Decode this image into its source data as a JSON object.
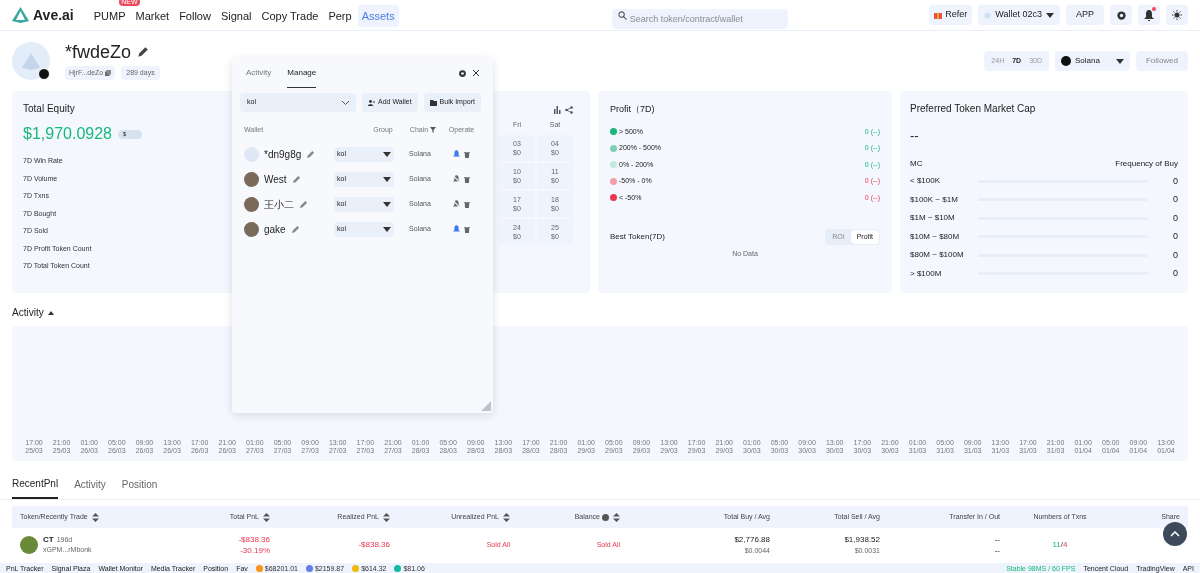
{
  "nav": {
    "logo": "Ave.ai",
    "items": [
      {
        "label": "PUMP",
        "badge": "NEW",
        "selected": false
      },
      {
        "label": "Market",
        "selected": false
      },
      {
        "label": "Follow",
        "selected": false
      },
      {
        "label": "Signal",
        "selected": false
      },
      {
        "label": "Copy Trade",
        "selected": false
      },
      {
        "label": "Perp",
        "selected": false
      },
      {
        "label": "Assets",
        "selected": true
      }
    ],
    "search": {
      "placeholder": "Search token/contract/wallet"
    },
    "refer": "Refer",
    "wallet": "Wallet 02c3",
    "app": "APP",
    "notification_dot": true
  },
  "profile": {
    "name": "*fwdeZo",
    "address": "HjrF...deZo",
    "age": "289 days",
    "periods": [
      {
        "label": "24H",
        "selected": false
      },
      {
        "label": "7D",
        "selected": true
      },
      {
        "label": "30D",
        "selected": false
      }
    ],
    "chain": "Solana",
    "follow": "Followed"
  },
  "equity": {
    "title": "Total Equity",
    "value": "$1,970.0928",
    "currency": "$",
    "stats": [
      "7D Win Rate",
      "7D Volume",
      "7D Txns",
      "7D Bought",
      "7D Sold",
      "7D Profit Token Count",
      "7D Total Token Count"
    ]
  },
  "calendar": {
    "days": [
      "Fri",
      "Sat"
    ],
    "weeks": [
      [
        {
          "date": "03",
          "amount": "$0"
        },
        {
          "date": "04",
          "amount": "$0"
        }
      ],
      [
        {
          "date": "10",
          "amount": "$0"
        },
        {
          "date": "11",
          "amount": "$0"
        }
      ],
      [
        {
          "date": "17",
          "amount": "$0"
        },
        {
          "date": "18",
          "amount": "$0"
        }
      ],
      [
        {
          "date": "24",
          "amount": "$0"
        },
        {
          "date": "25",
          "amount": "$0"
        }
      ]
    ]
  },
  "profit": {
    "title": "Profit（7D)",
    "buckets": [
      {
        "label": "> 500%",
        "value": "0 (--)",
        "color": "#16b979",
        "kind": "gain"
      },
      {
        "label": "200% - 500%",
        "value": "0 (--)",
        "color": "#7fd0b0",
        "kind": "gain"
      },
      {
        "label": "0% - 200%",
        "value": "0 (--)",
        "color": "#c6e8dc",
        "kind": "gain"
      },
      {
        "label": "-50% - 0%",
        "value": "0 (--)",
        "color": "#f3a0ad",
        "kind": "loss"
      },
      {
        "label": "< -50%",
        "value": "0 (--)",
        "color": "#e8384f",
        "kind": "loss"
      }
    ],
    "best_title": "Best Token(7D)",
    "toggle": [
      {
        "label": "ROI",
        "selected": false
      },
      {
        "label": "Profit",
        "selected": true
      }
    ],
    "empty": "No Data"
  },
  "market_cap": {
    "title": "Preferred Token Market Cap",
    "value": "--",
    "col1": "MC",
    "col2": "Frequency of Buy",
    "rows": [
      {
        "range": "< $100K",
        "count": "0",
        "level": 0
      },
      {
        "range": "$100K ~ $1M",
        "count": "0",
        "level": 0
      },
      {
        "range": "$1M ~ $10M",
        "count": "0",
        "level": 0
      },
      {
        "range": "$10M ~ $80M",
        "count": "0",
        "level": 0
      },
      {
        "range": "$80M ~ $100M",
        "count": "0",
        "level": 0
      },
      {
        "range": "> $100M",
        "count": "0",
        "level": 0
      }
    ]
  },
  "activity": {
    "title": "Activity",
    "expanded": true,
    "time_labels": [
      [
        "17:00",
        "25/03"
      ],
      [
        "21:00",
        "25/03"
      ],
      [
        "01:00",
        "26/03"
      ],
      [
        "05:00",
        "26/03"
      ],
      [
        "09:00",
        "26/03"
      ],
      [
        "13:00",
        "26/03"
      ],
      [
        "17:00",
        "26/03"
      ],
      [
        "21:00",
        "26/03"
      ],
      [
        "01:00",
        "27/03"
      ],
      [
        "05:00",
        "27/03"
      ],
      [
        "09:00",
        "27/03"
      ],
      [
        "13:00",
        "27/03"
      ],
      [
        "17:00",
        "27/03"
      ],
      [
        "21:00",
        "27/03"
      ],
      [
        "01:00",
        "28/03"
      ],
      [
        "05:00",
        "28/03"
      ],
      [
        "09:00",
        "28/03"
      ],
      [
        "13:00",
        "28/03"
      ],
      [
        "17:00",
        "28/03"
      ],
      [
        "21:00",
        "28/03"
      ],
      [
        "01:00",
        "29/03"
      ],
      [
        "05:00",
        "29/03"
      ],
      [
        "09:00",
        "29/03"
      ],
      [
        "13:00",
        "29/03"
      ],
      [
        "17:00",
        "29/03"
      ],
      [
        "21:00",
        "29/03"
      ],
      [
        "01:00",
        "30/03"
      ],
      [
        "05:00",
        "30/03"
      ],
      [
        "09:00",
        "30/03"
      ],
      [
        "13:00",
        "30/03"
      ],
      [
        "17:00",
        "30/03"
      ],
      [
        "21:00",
        "30/03"
      ],
      [
        "01:00",
        "31/03"
      ],
      [
        "05:00",
        "31/03"
      ],
      [
        "09:00",
        "31/03"
      ],
      [
        "13:00",
        "31/03"
      ],
      [
        "17:00",
        "31/03"
      ],
      [
        "21:00",
        "31/03"
      ],
      [
        "01:00",
        "01/04"
      ],
      [
        "05:00",
        "01/04"
      ],
      [
        "09:00",
        "01/04"
      ],
      [
        "13:00",
        "01/04"
      ]
    ]
  },
  "popup": {
    "tabs": [
      {
        "label": "Activity",
        "selected": false
      },
      {
        "label": "Manage",
        "selected": true
      }
    ],
    "group": "kol",
    "add_wallet": "Add Wallet",
    "bulk_import": "Bulk Import",
    "columns": [
      "Wallet",
      "Group",
      "Chain",
      "Operate"
    ],
    "wallets": [
      {
        "name": "*dn9g8g",
        "group": "kol",
        "chain": "Solana",
        "notify": true
      },
      {
        "name": "West",
        "group": "kol",
        "chain": "Solana",
        "notify": false
      },
      {
        "name": "王小二",
        "group": "kol",
        "chain": "Solana",
        "notify": false
      },
      {
        "name": "gake",
        "group": "kol",
        "chain": "Solana",
        "notify": true
      }
    ]
  },
  "bottom_tabs": [
    {
      "label": "RecentPnl",
      "selected": true
    },
    {
      "label": "Activity",
      "selected": false
    },
    {
      "label": "Position",
      "selected": false
    }
  ],
  "table": {
    "columns": [
      {
        "label": "Token/Recently Trade",
        "sortable": true
      },
      {
        "label": "Total PnL",
        "sortable": true
      },
      {
        "label": "Realized PnL",
        "sortable": true
      },
      {
        "label": "Unrealized PnL",
        "sortable": true
      },
      {
        "label": "Balance",
        "sortable": true,
        "info": true
      },
      {
        "label": "Total Buy / Avg",
        "sortable": false
      },
      {
        "label": "Total Sell / Avg",
        "sortable": false
      },
      {
        "label": "Transfer In / Out",
        "sortable": false
      },
      {
        "label": "Numbers of Txns",
        "sortable": false
      },
      {
        "label": "Share",
        "sortable": false
      }
    ],
    "rows": [
      {
        "token": "CT",
        "age": "196d",
        "address": "xGPM...rMbonk",
        "total_pnl": "-$838.36",
        "total_pnl_pct": "-30.19%",
        "realized": "-$838.36",
        "unrealized": "Sold All",
        "balance": "Sold All",
        "buy": "$2,776.88",
        "buy_avg": "$0.0044",
        "sell": "$1,938.52",
        "sell_avg": "$0.0031",
        "transfer_in": "--",
        "transfer_out": "--",
        "txns_buy": "11",
        "txns_separator": "/",
        "txns_sell": "4"
      }
    ]
  },
  "status_bar": {
    "tools": [
      "PnL Tracker",
      "Signal Plaza",
      "Wallet Monitor",
      "Media Tracker",
      "Position",
      "Fav"
    ],
    "prices": [
      {
        "value": "$68201.01",
        "color": "#f7931a"
      },
      {
        "value": "$2159.87",
        "color": "#627eea"
      },
      {
        "value": "$614.32",
        "color": "#f0b90b"
      },
      {
        "value": "$81.06",
        "color": "#14b8a6"
      }
    ],
    "status": "Stable 98MS / 60 FPS",
    "links": [
      "Tencent Cloud",
      "TradingView",
      "API"
    ]
  }
}
